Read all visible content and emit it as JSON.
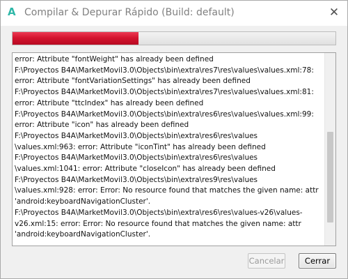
{
  "window": {
    "app_icon": "A",
    "app_icon_name": "b4a-logo-icon",
    "title": "Compilar & Depurar Rápido (Build: default)",
    "close_glyph": "✕"
  },
  "progress": {
    "fraction": 0.39,
    "color": "#d4142f"
  },
  "log": {
    "text": "error: Attribute \"fontWeight\" has already been defined\nF:\\Proyectos B4A\\MarketMovil3.0\\Objects\\bin\\extra\\res7\\res\\values\\values.xml:78:\nerror: Attribute \"fontVariationSettings\" has already been defined\nF:\\Proyectos B4A\\MarketMovil3.0\\Objects\\bin\\extra\\res7\\res\\values\\values.xml:81:\nerror: Attribute \"ttcIndex\" has already been defined\nF:\\Proyectos B4A\\MarketMovil3.0\\Objects\\bin\\extra\\res6\\res\\values\\values.xml:99:\nerror: Attribute \"icon\" has already been defined\nF:\\Proyectos B4A\\MarketMovil3.0\\Objects\\bin\\extra\\res6\\res\\values\n\\values.xml:963: error: Attribute \"iconTint\" has already been defined\nF:\\Proyectos B4A\\MarketMovil3.0\\Objects\\bin\\extra\\res6\\res\\values\n\\values.xml:1041: error: Attribute \"closeIcon\" has already been defined\nF:\\Proyectos B4A\\MarketMovil3.0\\Objects\\bin\\extra\\res9\\res\\values\n\\values.xml:928: error: Error: No resource found that matches the given name: attr\n'android:keyboardNavigationCluster'.\nF:\\Proyectos B4A\\MarketMovil3.0\\Objects\\bin\\extra\\res6\\res\\values-v26\\values-\nv26.xml:15: error: Error: No resource found that matches the given name: attr\n'android:keyboardNavigationCluster'.",
    "scroll_position": 0.78
  },
  "buttons": {
    "cancel_label": "Cancelar",
    "close_label": "Cerrar"
  }
}
